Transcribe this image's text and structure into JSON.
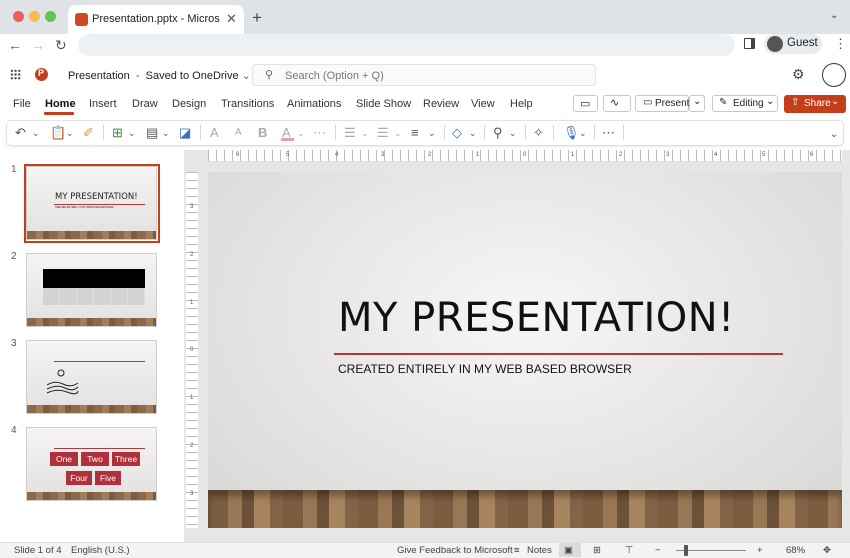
{
  "browser": {
    "tab_title": "Presentation.pptx - Microsoft PowerPoint",
    "tab_close": "✕",
    "new_tab": "+",
    "profile": "Guest"
  },
  "app": {
    "doc_name": "Presentation",
    "save_status": "Saved to OneDrive",
    "search_placeholder": "Search (Option + Q)",
    "logo_letter": "P"
  },
  "ribbon": {
    "tabs": [
      "File",
      "Home",
      "Insert",
      "Draw",
      "Design",
      "Transitions",
      "Animations",
      "Slide Show",
      "Review",
      "View",
      "Help"
    ],
    "active_tab": "Home",
    "present_label": "Present",
    "editing_label": "Editing",
    "share_label": "Share"
  },
  "thumbnails": [
    {
      "num": "1",
      "title": "MY PRESENTATION!",
      "subtitle": "CREATED ENTIRELY IN MY WEB BASED BROWSER"
    },
    {
      "num": "2"
    },
    {
      "num": "3"
    },
    {
      "num": "4",
      "words_row1": [
        "One",
        "Two",
        "Three"
      ],
      "words_row2": [
        "Four",
        "Five"
      ]
    }
  ],
  "ruler": {
    "h_numbers": [
      "6",
      "5",
      "4",
      "3",
      "2",
      "1",
      "0",
      "1",
      "2",
      "3",
      "4",
      "5",
      "6"
    ],
    "v_numbers": [
      "3",
      "2",
      "1",
      "0",
      "1",
      "2",
      "3"
    ]
  },
  "slide": {
    "title": "MY PRESENTATION!",
    "subtitle": "CREATED ENTIRELY IN MY WEB BASED BROWSER"
  },
  "status": {
    "slide_info": "Slide 1 of 4",
    "language": "English (U.S.)",
    "feedback": "Give Feedback to Microsoft",
    "notes": "Notes",
    "zoom": "68%"
  },
  "colors": {
    "accent": "#c43e1c",
    "brand": "#d24726",
    "slide_rule": "#b5373d"
  }
}
